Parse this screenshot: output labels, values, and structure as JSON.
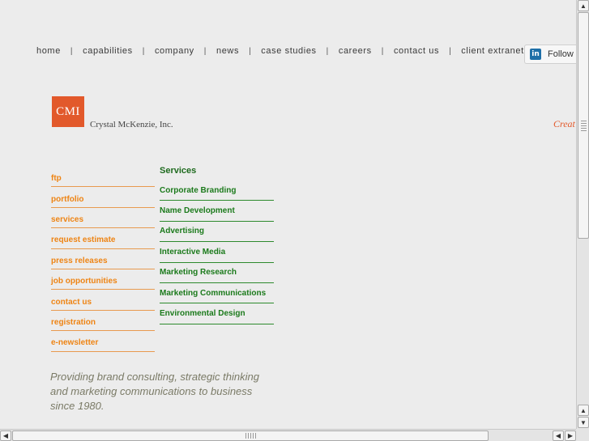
{
  "topnav": {
    "items": [
      "home",
      "capabilities",
      "company",
      "news",
      "case studies",
      "careers",
      "contact us",
      "client extranet"
    ],
    "separator": "|"
  },
  "linkedin": {
    "icon": "linkedin-icon",
    "icon_text": "in",
    "label": "Follow"
  },
  "logo": {
    "mark": "CMI",
    "name": "Crystal McKenzie, Inc.",
    "tagline": "Creat"
  },
  "leftmenu": {
    "items": [
      "ftp",
      "portfolio",
      "services",
      "request estimate",
      "press releases",
      "job opportunities",
      "contact us",
      "registration",
      "e-newsletter"
    ]
  },
  "services": {
    "heading": "Services",
    "items": [
      "Corporate Branding",
      "Name Development",
      "Advertising",
      "Interactive Media",
      "Marketing Research",
      "Marketing Communications",
      "Environmental Design"
    ]
  },
  "description": "Providing brand consulting, strategic thinking and marketing communications to business since 1980.",
  "colors": {
    "accent_orange": "#ee8414",
    "accent_green": "#1b7a1b",
    "logo_bg": "#e2592b"
  }
}
